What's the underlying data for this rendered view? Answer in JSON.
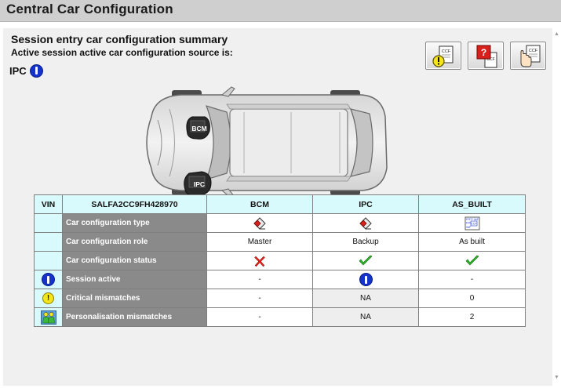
{
  "window": {
    "title": "Central Car Configuration"
  },
  "summary": {
    "heading": "Session entry car configuration summary",
    "subheading": "Active session active car configuration source is:",
    "source": "IPC"
  },
  "toolbar": {
    "buttons": [
      {
        "name": "critical-mismatch-ccf-button",
        "icon": "ccf-warning-icon"
      },
      {
        "name": "unknown-ccf-button",
        "icon": "ccf-question-icon"
      },
      {
        "name": "select-ccf-button",
        "icon": "ccf-hand-icon"
      }
    ],
    "icon_text": "CCF"
  },
  "car": {
    "modules": [
      {
        "label": "BCM"
      },
      {
        "label": "IPC"
      }
    ]
  },
  "table": {
    "headers": [
      "VIN",
      "SALFA2CC9FH428970",
      "BCM",
      "IPC",
      "AS_BUILT"
    ],
    "as_built_icon_text": [
      "FFFF 0#F",
      "FFF",
      "CCF",
      "0#F"
    ],
    "rows": [
      {
        "label": "Car configuration type",
        "row_icon": "",
        "cells": [
          {
            "kind": "icon",
            "icon": "eraser-module-icon"
          },
          {
            "kind": "icon",
            "icon": "eraser-module-icon"
          },
          {
            "kind": "icon",
            "icon": "ccf-file-icon"
          }
        ]
      },
      {
        "label": "Car configuration role",
        "row_icon": "",
        "cells": [
          {
            "kind": "text",
            "text": "Master"
          },
          {
            "kind": "text",
            "text": "Backup"
          },
          {
            "kind": "text",
            "text": "As built"
          }
        ]
      },
      {
        "label": "Car configuration status",
        "row_icon": "",
        "cells": [
          {
            "kind": "icon",
            "icon": "red-cross-icon"
          },
          {
            "kind": "icon",
            "icon": "green-check-icon"
          },
          {
            "kind": "icon",
            "icon": "green-check-icon"
          }
        ]
      },
      {
        "label": "Session active",
        "row_icon": "info-icon",
        "cells": [
          {
            "kind": "text",
            "text": "-"
          },
          {
            "kind": "icon",
            "icon": "info-icon"
          },
          {
            "kind": "text",
            "text": "-"
          }
        ]
      },
      {
        "label": "Critical mismatches",
        "row_icon": "warning-icon",
        "row_icon_text": "!",
        "cells": [
          {
            "kind": "text",
            "text": "-"
          },
          {
            "kind": "text",
            "text": "NA",
            "grey": true
          },
          {
            "kind": "text",
            "text": "0"
          }
        ]
      },
      {
        "label": "Personalisation mismatches",
        "row_icon": "people-icon",
        "cells": [
          {
            "kind": "text",
            "text": "-"
          },
          {
            "kind": "text",
            "text": "NA",
            "grey": true
          },
          {
            "kind": "text",
            "text": "2"
          }
        ]
      }
    ]
  },
  "colors": {
    "header_cell": "#d9fafc",
    "row_label_bg": "#8a8a8a",
    "info_blue": "#1533c8",
    "check_green": "#2fb52c",
    "cross_red": "#e0201c",
    "warning_yellow": "#f5e51d"
  }
}
